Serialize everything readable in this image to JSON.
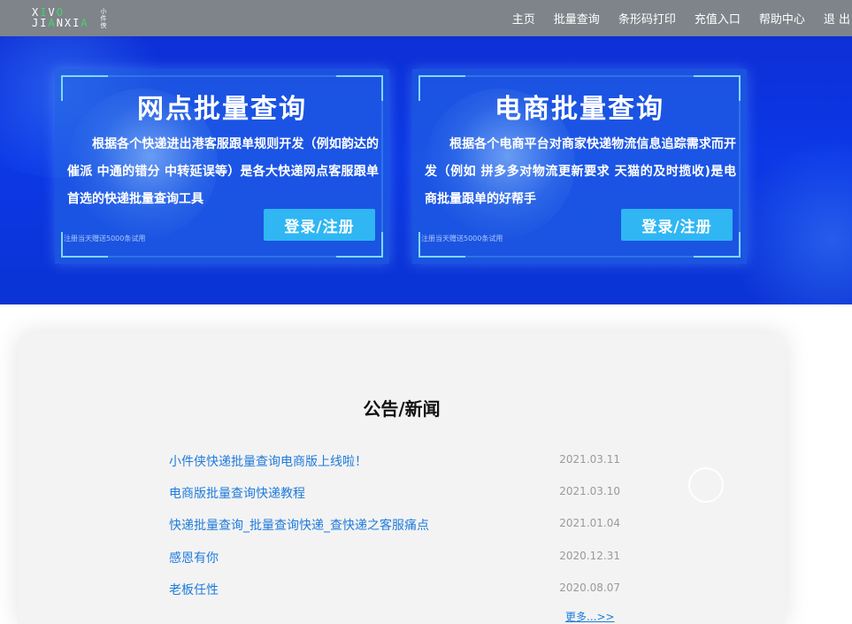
{
  "header": {
    "logo": {
      "line1": "XIVO",
      "line2": "JIANXIA",
      "seal": "小件侠"
    },
    "nav": [
      "主页",
      "批量查询",
      "条形码打印",
      "充值入口",
      "帮助中心",
      "退 出"
    ]
  },
  "hero": {
    "cards": [
      {
        "title": "网点批量查询",
        "description": "根据各个快递进出港客服跟单规则开发（例如韵达的催派 中通的错分 中转延误等）是各大快递网点客服跟单首选的快递批量查询工具",
        "button": "登录/注册",
        "promo": "注册当天赠送5000条试用"
      },
      {
        "title": "电商批量查询",
        "description": "根据各个电商平台对商家快递物流信息追踪需求而开发（例如 拼多多对物流更新要求 天猫的及时揽收)是电商批量跟单的好帮手",
        "button": "登录/注册",
        "promo": "注册当天赠送5000条试用"
      }
    ]
  },
  "news": {
    "heading": "公告/新闻",
    "items": [
      {
        "title": "小件侠快递批量查询电商版上线啦！",
        "date": "2021.03.11"
      },
      {
        "title": "电商版批量查询快递教程",
        "date": "2021.03.10"
      },
      {
        "title": "快递批量查询_批量查询快递_查快递之客服痛点",
        "date": "2021.01.04"
      },
      {
        "title": "感恩有你",
        "date": "2020.12.31"
      },
      {
        "title": "老板任性",
        "date": "2020.08.07"
      }
    ],
    "more": "更多...>>"
  },
  "colors": {
    "nav_bg": "#7e8489",
    "hero_bg": "#0c38e6",
    "button": "#2fb6f3",
    "link": "#1f7bdc",
    "date": "#9a9a9a",
    "logo_accent": "#43d36b"
  }
}
